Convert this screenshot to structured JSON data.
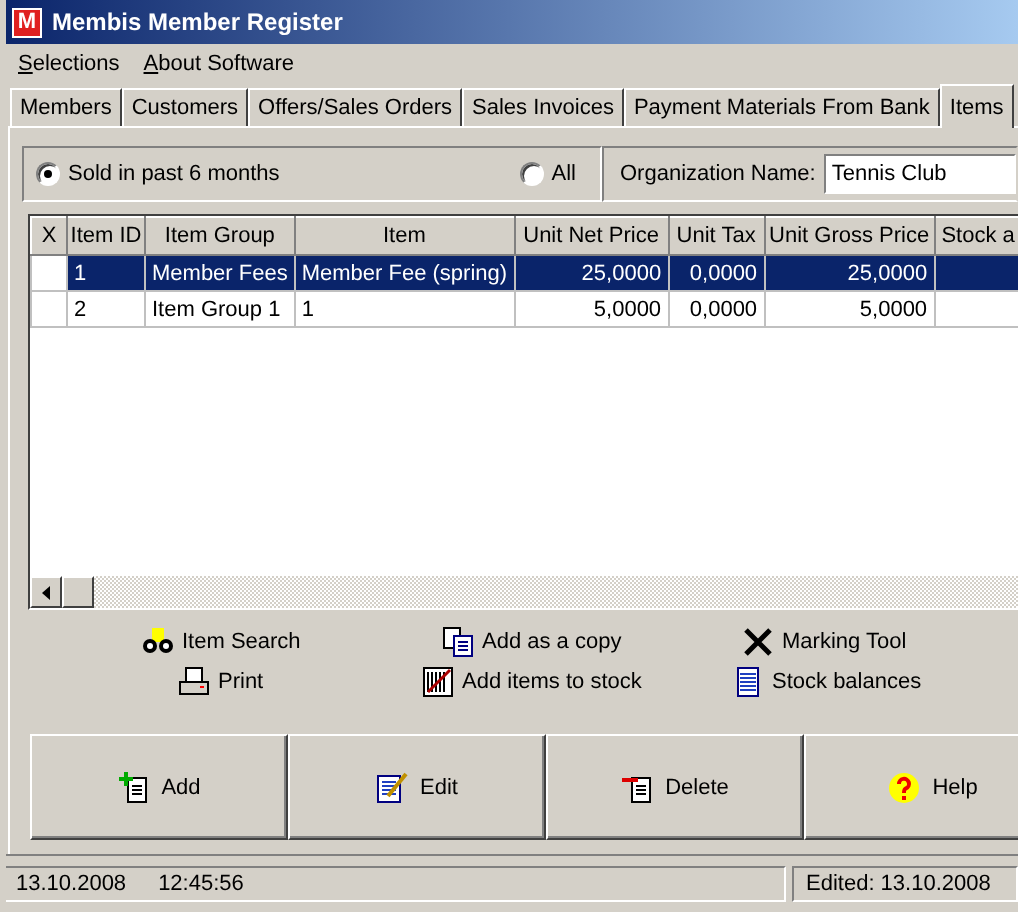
{
  "window": {
    "title": "Membis Member Register",
    "logo": "M"
  },
  "menu": [
    {
      "label": "Selections"
    },
    {
      "label": "About Software"
    }
  ],
  "tabs": [
    {
      "label": "Members",
      "selected": false
    },
    {
      "label": "Customers",
      "selected": false
    },
    {
      "label": "Offers/Sales Orders",
      "selected": false
    },
    {
      "label": "Sales Invoices",
      "selected": false
    },
    {
      "label": "Payment Materials From Bank",
      "selected": false
    },
    {
      "label": "Items",
      "selected": true
    }
  ],
  "filter": {
    "options": [
      {
        "label": "Sold in past 6 months",
        "selected": true
      },
      {
        "label": "All",
        "selected": false
      }
    ],
    "organization_label": "Organization Name:",
    "organization_value": "Tennis Club"
  },
  "table": {
    "marker_heading": "X",
    "columns": [
      "Item ID",
      "Item Group",
      "Item",
      "Unit Net Price",
      "Unit Tax",
      "Unit Gross Price",
      "Stock a"
    ],
    "rows": [
      {
        "selected": true,
        "cells": [
          "1",
          "Member Fees",
          "Member Fee (spring)",
          "25,0000",
          "0,0000",
          "25,0000",
          ""
        ]
      },
      {
        "selected": false,
        "cells": [
          "2",
          "Item Group 1",
          "1",
          "5,0000",
          "0,0000",
          "5,0000",
          ""
        ]
      }
    ]
  },
  "tools": [
    {
      "label": "Item Search",
      "kind": "search"
    },
    {
      "label": "Add as a copy",
      "kind": "copy"
    },
    {
      "label": "Marking Tool",
      "kind": "mark"
    },
    {
      "label": "Print",
      "kind": "print"
    },
    {
      "label": "Add items to stock",
      "kind": "stock"
    },
    {
      "label": "Stock balances",
      "kind": "balances"
    }
  ],
  "buttons": [
    {
      "label": "Add",
      "kind": "add"
    },
    {
      "label": "Edit",
      "kind": "edit"
    },
    {
      "label": "Delete",
      "kind": "delete"
    },
    {
      "label": "Help",
      "kind": "help"
    }
  ],
  "status_bar": {
    "date": "13.10.2008",
    "time": "12:45:56",
    "edited": "Edited: 13.10.2008"
  }
}
